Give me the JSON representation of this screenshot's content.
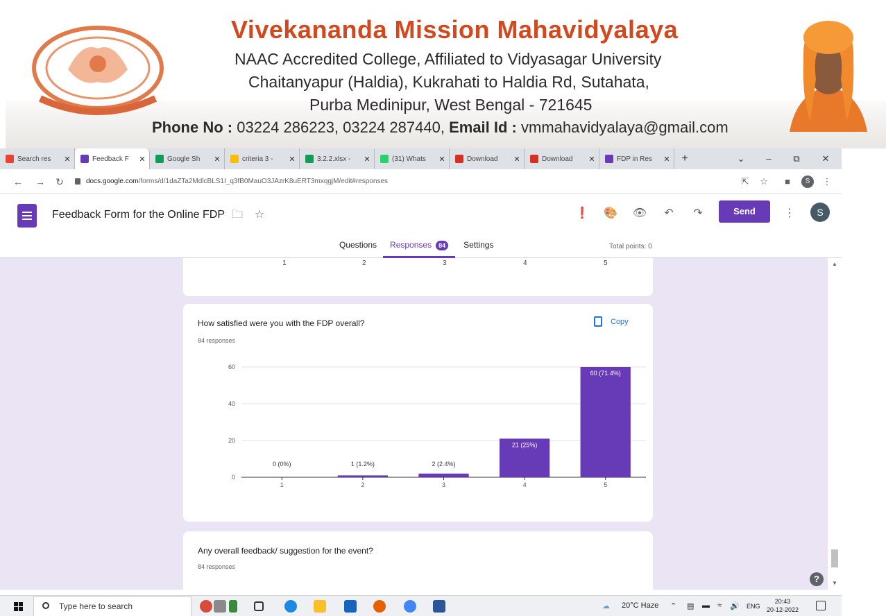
{
  "banner": {
    "college_name": "Vivekananda Mission Mahavidyalaya",
    "line1": "NAAC Accredited College, Affiliated to Vidyasagar University",
    "line2": "Chaitanyapur (Haldia), Kukrahati to Haldia Rd, Sutahata,",
    "line3": "Purba Medinipur, West Bengal - 721645",
    "phone_label": "Phone No :",
    "phone_value": " 03224 286223, 03224 287440, ",
    "email_label": "Email Id :",
    "email_value": " vmmahavidyalaya@gmail.com"
  },
  "browser": {
    "tabs": [
      {
        "label": "Search res",
        "icon": "gmail-icon",
        "color": "#ea4335",
        "active": false
      },
      {
        "label": "Feedback F",
        "icon": "forms-icon",
        "color": "#673ab7",
        "active": true
      },
      {
        "label": "Google Sh",
        "icon": "sheets-icon",
        "color": "#0f9d58",
        "active": false
      },
      {
        "label": "criteria 3 -",
        "icon": "drive-icon",
        "color": "#fbbc04",
        "active": false
      },
      {
        "label": "3.2.2.xlsx -",
        "icon": "sheets-icon",
        "color": "#0f9d58",
        "active": false
      },
      {
        "label": "(31) Whats",
        "icon": "whatsapp-icon",
        "color": "#25d366",
        "active": false
      },
      {
        "label": "Download",
        "icon": "download-icon",
        "color": "#d93025",
        "active": false
      },
      {
        "label": "Download",
        "icon": "download-icon",
        "color": "#d93025",
        "active": false
      },
      {
        "label": "FDP in Res",
        "icon": "forms-icon",
        "color": "#673ab7",
        "active": false
      }
    ],
    "url_host": "docs.google.com",
    "url_path": "/forms/d/1daZTa2MdlcBLS1I_q3fB0MauO3JAzrK8uERT3mxqgjM/edit#responses"
  },
  "form": {
    "title": "Feedback Form for the Online FDP",
    "send_label": "Send",
    "avatar_letter": "S",
    "tabs": {
      "questions": "Questions",
      "responses": "Responses",
      "responses_count": "84",
      "settings": "Settings"
    },
    "total_points": "Total points: 0"
  },
  "prev_card": {
    "ticks": [
      "1",
      "2",
      "3",
      "4",
      "5"
    ]
  },
  "question1": {
    "title": "How satisfied were you with the FDP overall?",
    "responses": "84 responses",
    "copy_label": "Copy"
  },
  "question2": {
    "title": "Any overall feedback/ suggestion for the event?",
    "responses": "84 responses"
  },
  "chart_data": {
    "type": "bar",
    "categories": [
      "1",
      "2",
      "3",
      "4",
      "5"
    ],
    "values": [
      0,
      1,
      2,
      21,
      60
    ],
    "data_labels": [
      "0 (0%)",
      "1 (1.2%)",
      "2 (2.4%)",
      "21 (25%)",
      "60 (71.4%)"
    ],
    "yticks": [
      0,
      20,
      40,
      60
    ],
    "ylim": [
      0,
      60
    ],
    "bar_color": "#673ab7",
    "grid": true
  },
  "taskbar": {
    "search_placeholder": "Type here to search",
    "weather": "20°C  Haze",
    "lang": "ENG",
    "time": "20:43",
    "date": "20-12-2022"
  },
  "colors": {
    "accent": "#673ab7",
    "page_bg": "#ebe4f5"
  }
}
